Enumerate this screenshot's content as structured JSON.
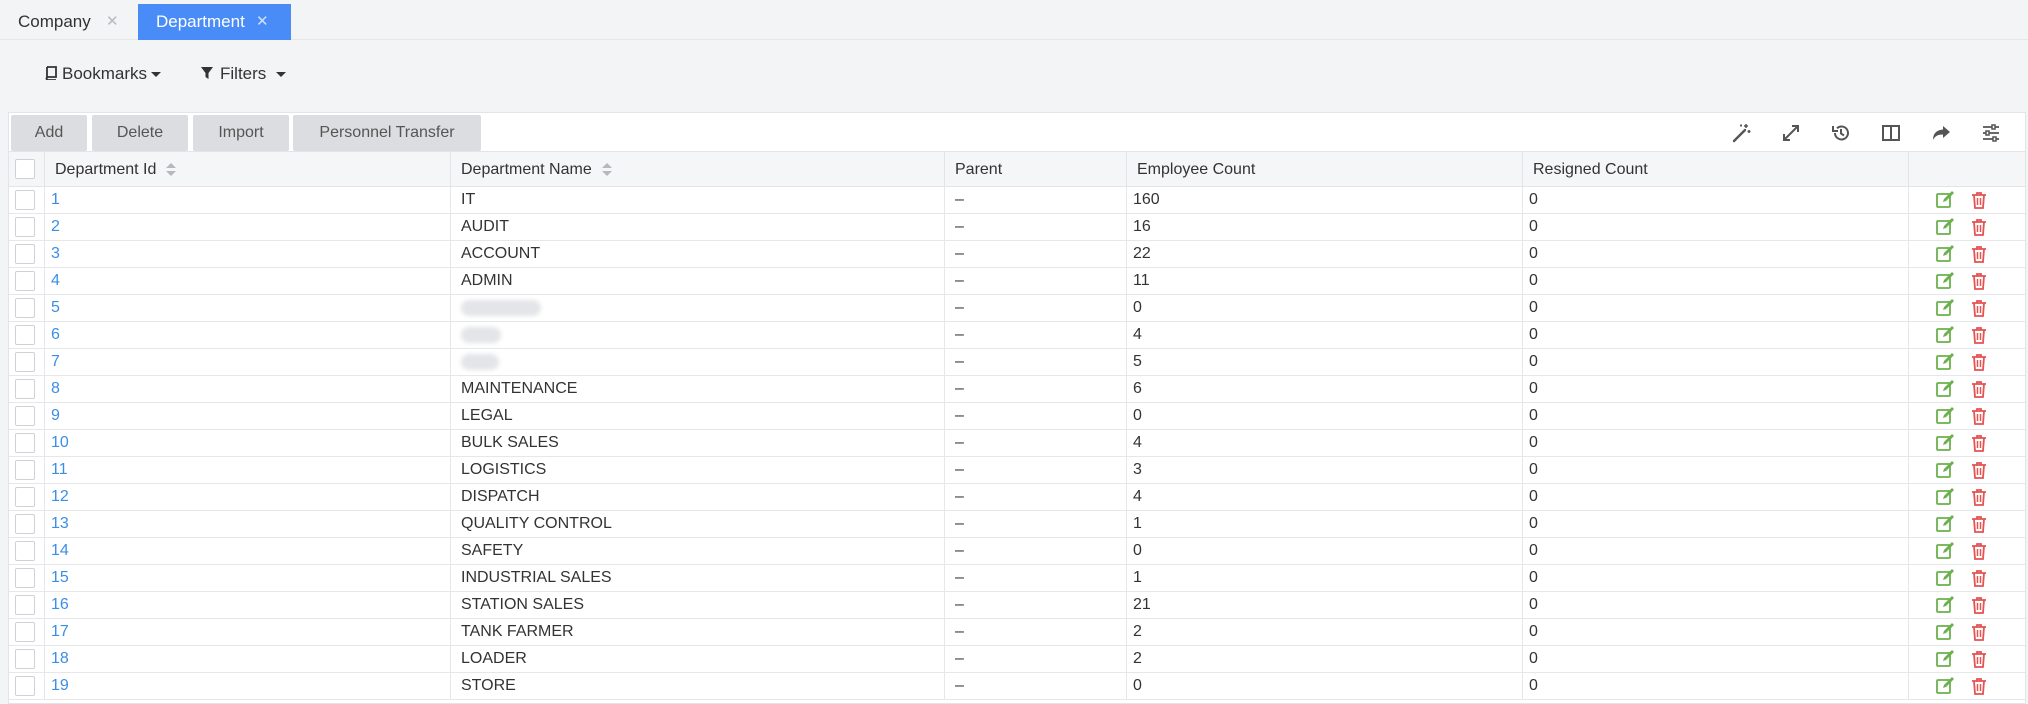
{
  "tabs": [
    {
      "label": "Company",
      "active": false
    },
    {
      "label": "Department",
      "active": true
    }
  ],
  "filterbar": {
    "bookmarks_label": "Bookmarks",
    "filters_label": "Filters"
  },
  "actions": {
    "add": "Add",
    "delete": "Delete",
    "import": "Import",
    "transfer": "Personnel Transfer"
  },
  "toolbar_icons": [
    "magic-wand-icon",
    "expand-icon",
    "history-icon",
    "columns-icon",
    "share-icon",
    "settings-sliders-icon"
  ],
  "table": {
    "columns": [
      "Department Id",
      "Department Name",
      "Parent",
      "Employee Count",
      "Resigned Count"
    ],
    "rows": [
      {
        "id": "1",
        "name": "IT",
        "parent": "–",
        "employees": "160",
        "resigned": "0"
      },
      {
        "id": "2",
        "name": "AUDIT",
        "parent": "–",
        "employees": "16",
        "resigned": "0"
      },
      {
        "id": "3",
        "name": "ACCOUNT",
        "parent": "–",
        "employees": "22",
        "resigned": "0"
      },
      {
        "id": "4",
        "name": "ADMIN",
        "parent": "–",
        "employees": "11",
        "resigned": "0"
      },
      {
        "id": "5",
        "name": "",
        "parent": "–",
        "employees": "0",
        "resigned": "0"
      },
      {
        "id": "6",
        "name": "",
        "parent": "–",
        "employees": "4",
        "resigned": "0"
      },
      {
        "id": "7",
        "name": "",
        "parent": "–",
        "employees": "5",
        "resigned": "0"
      },
      {
        "id": "8",
        "name": "MAINTENANCE",
        "parent": "–",
        "employees": "6",
        "resigned": "0"
      },
      {
        "id": "9",
        "name": "LEGAL",
        "parent": "–",
        "employees": "0",
        "resigned": "0"
      },
      {
        "id": "10",
        "name": "BULK SALES",
        "parent": "–",
        "employees": "4",
        "resigned": "0"
      },
      {
        "id": "11",
        "name": "LOGISTICS",
        "parent": "–",
        "employees": "3",
        "resigned": "0"
      },
      {
        "id": "12",
        "name": "DISPATCH",
        "parent": "–",
        "employees": "4",
        "resigned": "0"
      },
      {
        "id": "13",
        "name": "QUALITY CONTROL",
        "parent": "–",
        "employees": "1",
        "resigned": "0"
      },
      {
        "id": "14",
        "name": "SAFETY",
        "parent": "–",
        "employees": "0",
        "resigned": "0"
      },
      {
        "id": "15",
        "name": "INDUSTRIAL SALES",
        "parent": "–",
        "employees": "1",
        "resigned": "0"
      },
      {
        "id": "16",
        "name": "STATION SALES",
        "parent": "–",
        "employees": "21",
        "resigned": "0"
      },
      {
        "id": "17",
        "name": "TANK FARMER",
        "parent": "–",
        "employees": "2",
        "resigned": "0"
      },
      {
        "id": "18",
        "name": "LOADER",
        "parent": "–",
        "employees": "2",
        "resigned": "0"
      },
      {
        "id": "19",
        "name": "STORE",
        "parent": "–",
        "employees": "0",
        "resigned": "0"
      }
    ]
  },
  "colors": {
    "accent": "#4a8cf7",
    "link": "#3a8ee6",
    "edit": "#6ab04c",
    "delete": "#e55353"
  }
}
